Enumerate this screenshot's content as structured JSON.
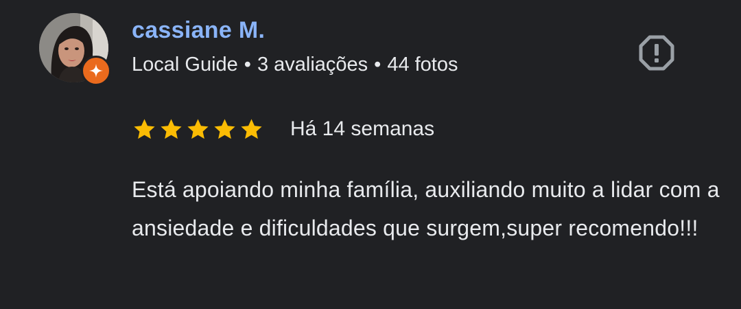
{
  "review": {
    "reviewer": {
      "name": "cassiane M.",
      "name_color": "#8ab4f8",
      "badge_color": "#ea6a1d"
    },
    "meta": {
      "level": "Local Guide",
      "reviews": "3 avaliações",
      "photos": "44 fotos",
      "separator": "•"
    },
    "rating": {
      "stars": 5,
      "max_stars": 5,
      "star_color": "#fbbc04"
    },
    "date": "Há 14 semanas",
    "text": "Está apoiando minha família, auxiliando muito a lidar com a ansiedade e dificuldades que surgem,super recomendo!!!",
    "icons": {
      "report": "report-flag-icon",
      "badge": "local-guide-star-icon"
    }
  }
}
